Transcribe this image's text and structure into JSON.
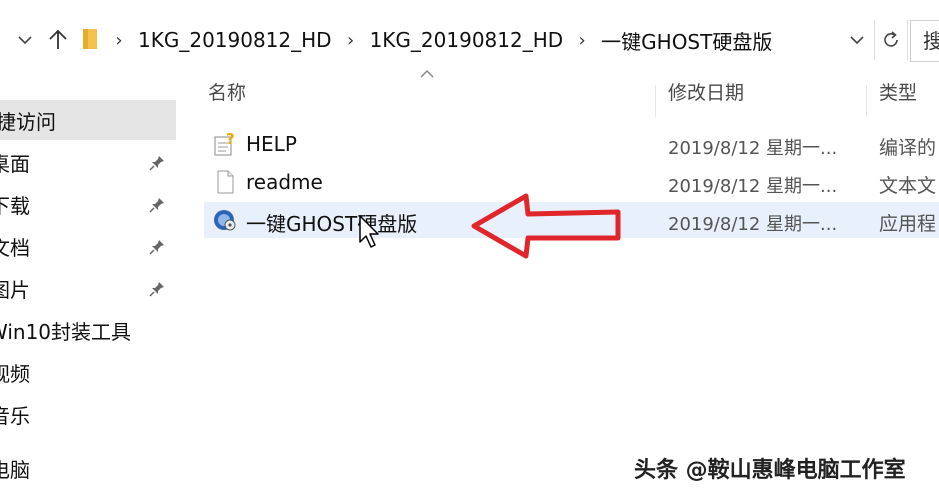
{
  "address_bar": {
    "breadcrumbs": [
      "1KG_20190812_HD",
      "1KG_20190812_HD",
      "一键GHOST硬盘版"
    ],
    "search_partial": "搜"
  },
  "sidebar": {
    "items": [
      {
        "label": "捷访问",
        "pinned": false,
        "selected": true
      },
      {
        "label": "桌面",
        "pinned": true
      },
      {
        "label": "下载",
        "pinned": true
      },
      {
        "label": "文档",
        "pinned": true
      },
      {
        "label": "图片",
        "pinned": true
      },
      {
        "label": "Win10封装工具",
        "pinned": false
      },
      {
        "label": "视频",
        "pinned": false
      },
      {
        "label": "音乐",
        "pinned": false
      },
      {
        "label": "电脑",
        "pinned": false
      }
    ]
  },
  "columns": {
    "name": "名称",
    "modified": "修改日期",
    "type": "类型"
  },
  "files": [
    {
      "name": "HELP",
      "modified": "2019/8/12 星期一...",
      "type": "编译的",
      "icon": "help-file-icon",
      "selected": false
    },
    {
      "name": "readme",
      "modified": "2019/8/12 星期一...",
      "type": "文本文",
      "icon": "text-file-icon",
      "selected": false
    },
    {
      "name": "一键GHOST硬盘版",
      "modified": "2019/8/12 星期一...",
      "type": "应用程",
      "icon": "ghost-app-icon",
      "selected": true
    }
  ],
  "annotation": {
    "arrow_color": "#e0262b"
  },
  "watermark": {
    "text": "头条 @鞍山惠峰电脑工作室"
  }
}
